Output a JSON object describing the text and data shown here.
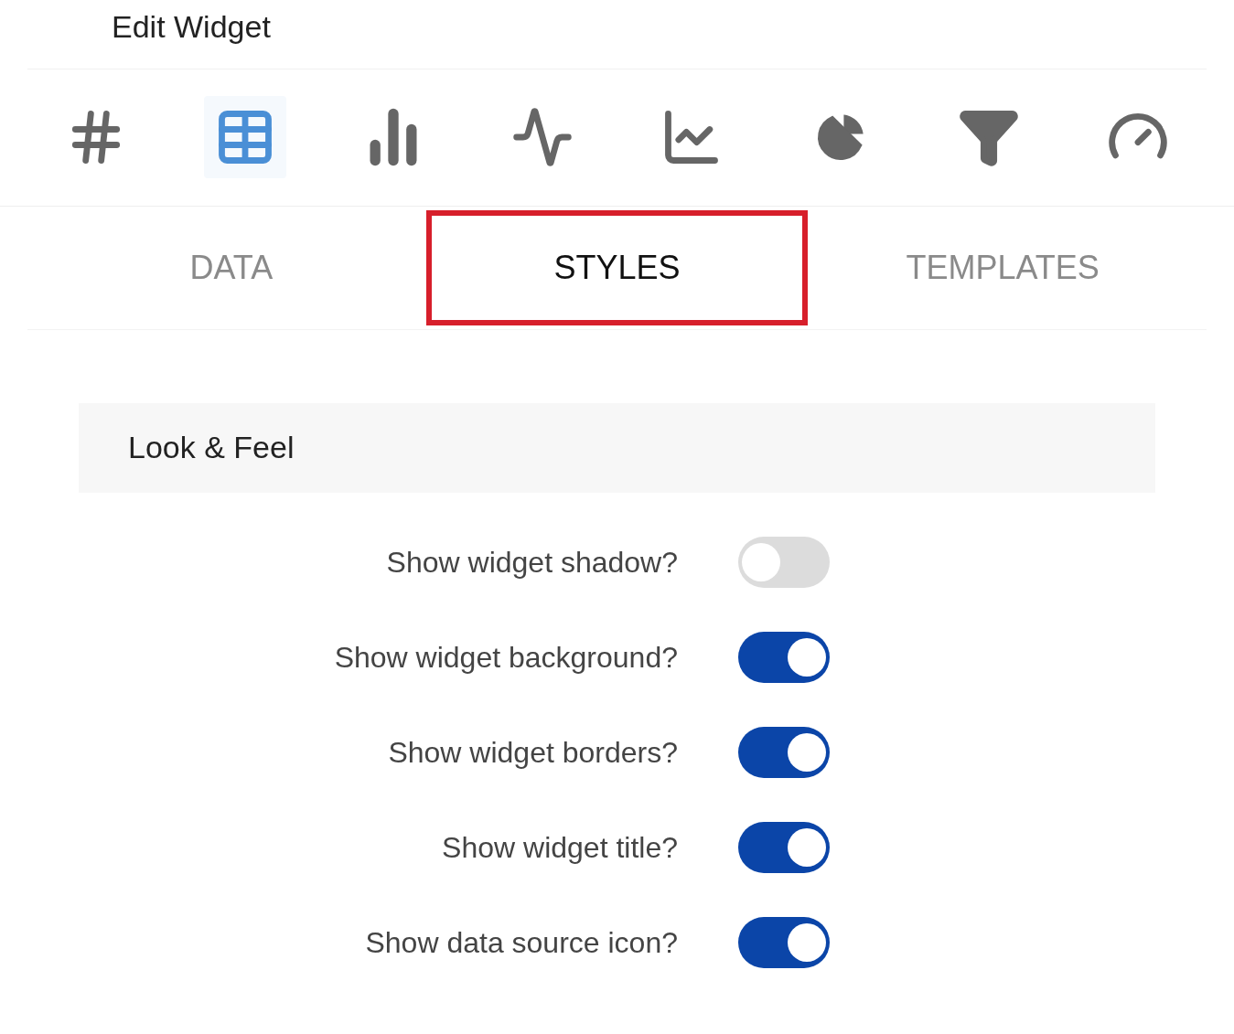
{
  "title": "Edit Widget",
  "chart_types": [
    {
      "kind": "number",
      "selected": false
    },
    {
      "kind": "table",
      "selected": true
    },
    {
      "kind": "bar",
      "selected": false
    },
    {
      "kind": "line",
      "selected": false
    },
    {
      "kind": "combo",
      "selected": false
    },
    {
      "kind": "pie",
      "selected": false
    },
    {
      "kind": "funnel",
      "selected": false
    },
    {
      "kind": "gauge",
      "selected": false
    }
  ],
  "tabs": [
    {
      "label": "DATA",
      "selected": false
    },
    {
      "label": "STYLES",
      "selected": true
    },
    {
      "label": "TEMPLATES",
      "selected": false
    }
  ],
  "section": {
    "title": "Look & Feel",
    "options": [
      {
        "label": "Show widget shadow?",
        "on": false
      },
      {
        "label": "Show widget background?",
        "on": true
      },
      {
        "label": "Show widget borders?",
        "on": true
      },
      {
        "label": "Show widget title?",
        "on": true
      },
      {
        "label": "Show data source icon?",
        "on": true
      }
    ]
  }
}
